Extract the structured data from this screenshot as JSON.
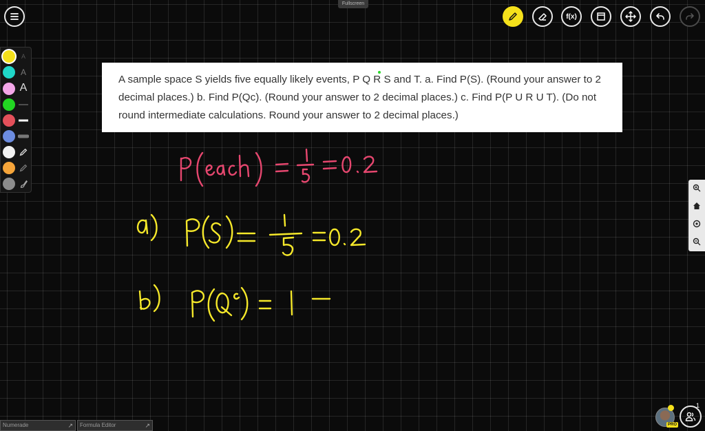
{
  "toolbar": {
    "fullscreen_label": "Fullscreen",
    "fx_label": "f(x)"
  },
  "palette": {
    "colors": [
      "#f5e11b",
      "#1fd6c8",
      "#f3a6e8",
      "#22d622",
      "#e4505a",
      "#6c8ce0",
      "#f2f2f2",
      "#f6a53a",
      "#8c8c8c"
    ],
    "selected_color": "#f5e11b",
    "text_tool_labels": [
      "A",
      "A",
      "A"
    ]
  },
  "question": {
    "text": "A sample space S yields five equally likely events, P Q R S and T. a. Find P(S). (Round your answer to 2 decimal places.) b. Find P(Qc). (Round your answer to 2 decimal places.) c. Find P(P U R U T). (Do not round intermediate calculations. Round your answer to 2 decimal places.)"
  },
  "handwriting": {
    "pink_color": "#e6476f",
    "yellow_color": "#f5e82a",
    "line1": "P(each) = 1/5 = 0.2",
    "line2": "a) P(S) = 1/5 = 0.2",
    "line3": "b) P(Q^c) = 1 -"
  },
  "bottom_tabs": {
    "numerade": "Numerade",
    "formula_editor": "Formula Editor"
  },
  "user": {
    "pro_label": "PRO",
    "participants_count": "1"
  }
}
